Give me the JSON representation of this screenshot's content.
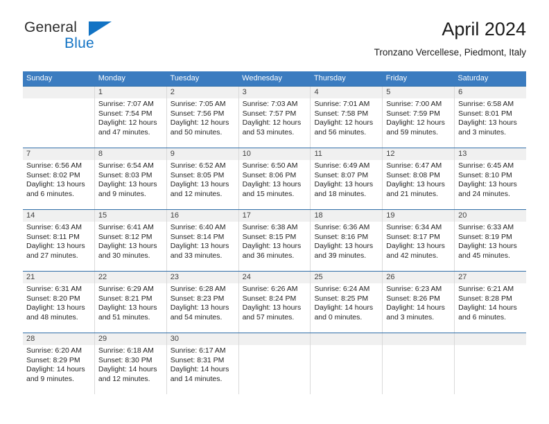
{
  "brand": {
    "line1": "General",
    "line2": "Blue",
    "triangle_icon": "triangle-icon",
    "color_dark": "#2b2b2b",
    "color_blue": "#1273c4"
  },
  "header": {
    "title": "April 2024",
    "subtitle": "Tronzano Vercellese, Piedmont, Italy"
  },
  "theme": {
    "header_blue": "#3b7cc0",
    "row_rule_blue": "#2e6da8",
    "daynum_band": "#f0f0f0",
    "cell_divider": "#d9d9d9"
  },
  "weekdays": [
    "Sunday",
    "Monday",
    "Tuesday",
    "Wednesday",
    "Thursday",
    "Friday",
    "Saturday"
  ],
  "weeks": [
    [
      {
        "day": "",
        "sunrise": "",
        "sunset": "",
        "daylight_line1": "",
        "daylight_line2": ""
      },
      {
        "day": "1",
        "sunrise": "Sunrise: 7:07 AM",
        "sunset": "Sunset: 7:54 PM",
        "daylight_line1": "Daylight: 12 hours",
        "daylight_line2": "and 47 minutes."
      },
      {
        "day": "2",
        "sunrise": "Sunrise: 7:05 AM",
        "sunset": "Sunset: 7:56 PM",
        "daylight_line1": "Daylight: 12 hours",
        "daylight_line2": "and 50 minutes."
      },
      {
        "day": "3",
        "sunrise": "Sunrise: 7:03 AM",
        "sunset": "Sunset: 7:57 PM",
        "daylight_line1": "Daylight: 12 hours",
        "daylight_line2": "and 53 minutes."
      },
      {
        "day": "4",
        "sunrise": "Sunrise: 7:01 AM",
        "sunset": "Sunset: 7:58 PM",
        "daylight_line1": "Daylight: 12 hours",
        "daylight_line2": "and 56 minutes."
      },
      {
        "day": "5",
        "sunrise": "Sunrise: 7:00 AM",
        "sunset": "Sunset: 7:59 PM",
        "daylight_line1": "Daylight: 12 hours",
        "daylight_line2": "and 59 minutes."
      },
      {
        "day": "6",
        "sunrise": "Sunrise: 6:58 AM",
        "sunset": "Sunset: 8:01 PM",
        "daylight_line1": "Daylight: 13 hours",
        "daylight_line2": "and 3 minutes."
      }
    ],
    [
      {
        "day": "7",
        "sunrise": "Sunrise: 6:56 AM",
        "sunset": "Sunset: 8:02 PM",
        "daylight_line1": "Daylight: 13 hours",
        "daylight_line2": "and 6 minutes."
      },
      {
        "day": "8",
        "sunrise": "Sunrise: 6:54 AM",
        "sunset": "Sunset: 8:03 PM",
        "daylight_line1": "Daylight: 13 hours",
        "daylight_line2": "and 9 minutes."
      },
      {
        "day": "9",
        "sunrise": "Sunrise: 6:52 AM",
        "sunset": "Sunset: 8:05 PM",
        "daylight_line1": "Daylight: 13 hours",
        "daylight_line2": "and 12 minutes."
      },
      {
        "day": "10",
        "sunrise": "Sunrise: 6:50 AM",
        "sunset": "Sunset: 8:06 PM",
        "daylight_line1": "Daylight: 13 hours",
        "daylight_line2": "and 15 minutes."
      },
      {
        "day": "11",
        "sunrise": "Sunrise: 6:49 AM",
        "sunset": "Sunset: 8:07 PM",
        "daylight_line1": "Daylight: 13 hours",
        "daylight_line2": "and 18 minutes."
      },
      {
        "day": "12",
        "sunrise": "Sunrise: 6:47 AM",
        "sunset": "Sunset: 8:08 PM",
        "daylight_line1": "Daylight: 13 hours",
        "daylight_line2": "and 21 minutes."
      },
      {
        "day": "13",
        "sunrise": "Sunrise: 6:45 AM",
        "sunset": "Sunset: 8:10 PM",
        "daylight_line1": "Daylight: 13 hours",
        "daylight_line2": "and 24 minutes."
      }
    ],
    [
      {
        "day": "14",
        "sunrise": "Sunrise: 6:43 AM",
        "sunset": "Sunset: 8:11 PM",
        "daylight_line1": "Daylight: 13 hours",
        "daylight_line2": "and 27 minutes."
      },
      {
        "day": "15",
        "sunrise": "Sunrise: 6:41 AM",
        "sunset": "Sunset: 8:12 PM",
        "daylight_line1": "Daylight: 13 hours",
        "daylight_line2": "and 30 minutes."
      },
      {
        "day": "16",
        "sunrise": "Sunrise: 6:40 AM",
        "sunset": "Sunset: 8:14 PM",
        "daylight_line1": "Daylight: 13 hours",
        "daylight_line2": "and 33 minutes."
      },
      {
        "day": "17",
        "sunrise": "Sunrise: 6:38 AM",
        "sunset": "Sunset: 8:15 PM",
        "daylight_line1": "Daylight: 13 hours",
        "daylight_line2": "and 36 minutes."
      },
      {
        "day": "18",
        "sunrise": "Sunrise: 6:36 AM",
        "sunset": "Sunset: 8:16 PM",
        "daylight_line1": "Daylight: 13 hours",
        "daylight_line2": "and 39 minutes."
      },
      {
        "day": "19",
        "sunrise": "Sunrise: 6:34 AM",
        "sunset": "Sunset: 8:17 PM",
        "daylight_line1": "Daylight: 13 hours",
        "daylight_line2": "and 42 minutes."
      },
      {
        "day": "20",
        "sunrise": "Sunrise: 6:33 AM",
        "sunset": "Sunset: 8:19 PM",
        "daylight_line1": "Daylight: 13 hours",
        "daylight_line2": "and 45 minutes."
      }
    ],
    [
      {
        "day": "21",
        "sunrise": "Sunrise: 6:31 AM",
        "sunset": "Sunset: 8:20 PM",
        "daylight_line1": "Daylight: 13 hours",
        "daylight_line2": "and 48 minutes."
      },
      {
        "day": "22",
        "sunrise": "Sunrise: 6:29 AM",
        "sunset": "Sunset: 8:21 PM",
        "daylight_line1": "Daylight: 13 hours",
        "daylight_line2": "and 51 minutes."
      },
      {
        "day": "23",
        "sunrise": "Sunrise: 6:28 AM",
        "sunset": "Sunset: 8:23 PM",
        "daylight_line1": "Daylight: 13 hours",
        "daylight_line2": "and 54 minutes."
      },
      {
        "day": "24",
        "sunrise": "Sunrise: 6:26 AM",
        "sunset": "Sunset: 8:24 PM",
        "daylight_line1": "Daylight: 13 hours",
        "daylight_line2": "and 57 minutes."
      },
      {
        "day": "25",
        "sunrise": "Sunrise: 6:24 AM",
        "sunset": "Sunset: 8:25 PM",
        "daylight_line1": "Daylight: 14 hours",
        "daylight_line2": "and 0 minutes."
      },
      {
        "day": "26",
        "sunrise": "Sunrise: 6:23 AM",
        "sunset": "Sunset: 8:26 PM",
        "daylight_line1": "Daylight: 14 hours",
        "daylight_line2": "and 3 minutes."
      },
      {
        "day": "27",
        "sunrise": "Sunrise: 6:21 AM",
        "sunset": "Sunset: 8:28 PM",
        "daylight_line1": "Daylight: 14 hours",
        "daylight_line2": "and 6 minutes."
      }
    ],
    [
      {
        "day": "28",
        "sunrise": "Sunrise: 6:20 AM",
        "sunset": "Sunset: 8:29 PM",
        "daylight_line1": "Daylight: 14 hours",
        "daylight_line2": "and 9 minutes."
      },
      {
        "day": "29",
        "sunrise": "Sunrise: 6:18 AM",
        "sunset": "Sunset: 8:30 PM",
        "daylight_line1": "Daylight: 14 hours",
        "daylight_line2": "and 12 minutes."
      },
      {
        "day": "30",
        "sunrise": "Sunrise: 6:17 AM",
        "sunset": "Sunset: 8:31 PM",
        "daylight_line1": "Daylight: 14 hours",
        "daylight_line2": "and 14 minutes."
      },
      {
        "day": "",
        "sunrise": "",
        "sunset": "",
        "daylight_line1": "",
        "daylight_line2": ""
      },
      {
        "day": "",
        "sunrise": "",
        "sunset": "",
        "daylight_line1": "",
        "daylight_line2": ""
      },
      {
        "day": "",
        "sunrise": "",
        "sunset": "",
        "daylight_line1": "",
        "daylight_line2": ""
      },
      {
        "day": "",
        "sunrise": "",
        "sunset": "",
        "daylight_line1": "",
        "daylight_line2": ""
      }
    ]
  ]
}
